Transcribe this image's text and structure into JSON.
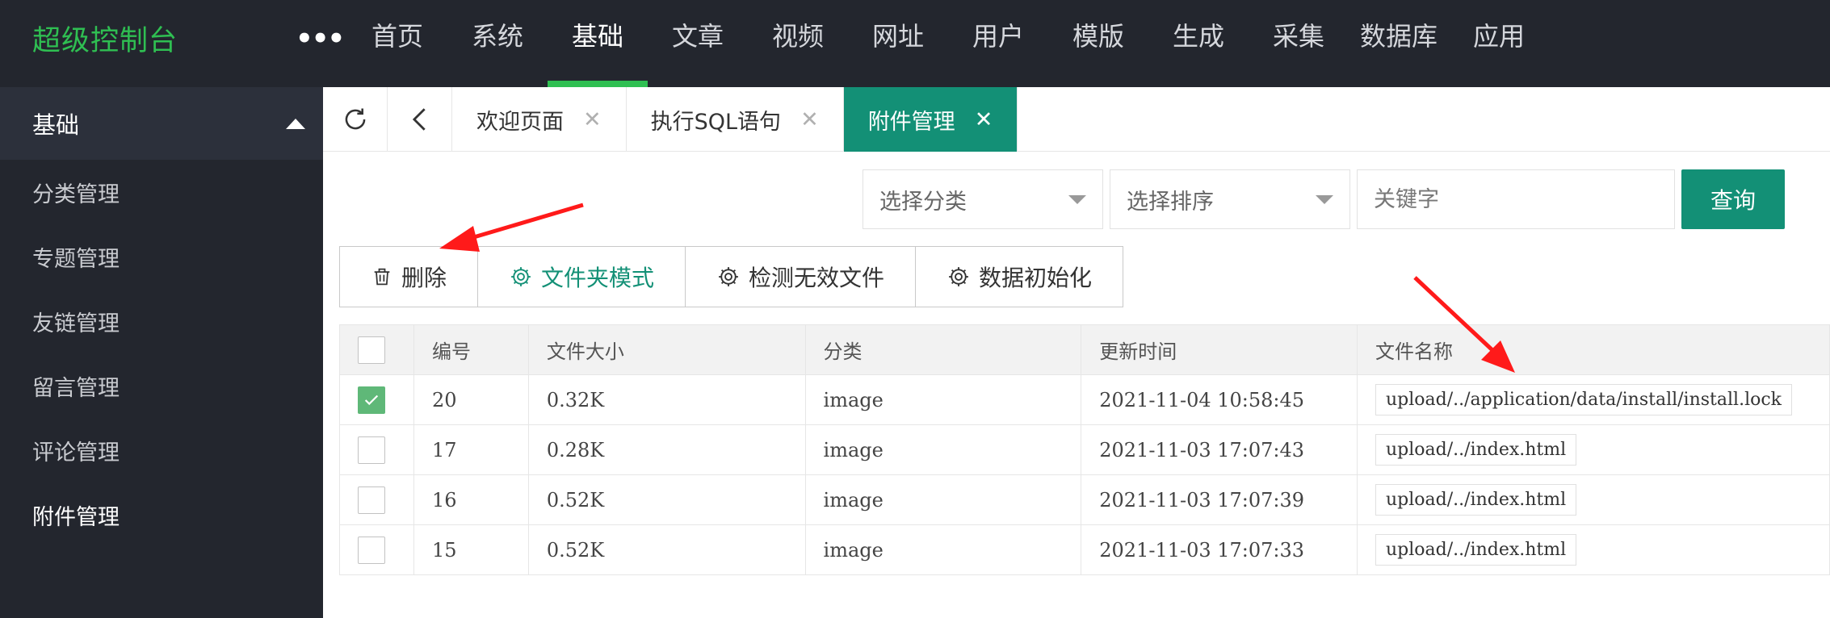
{
  "app": {
    "logo": "超级控制台",
    "more_icon": "ellipsis-icon"
  },
  "nav": {
    "items": [
      "首页",
      "系统",
      "基础",
      "文章",
      "视频",
      "网址",
      "用户",
      "模版",
      "生成",
      "采集",
      "数据库",
      "应用"
    ],
    "active": "基础"
  },
  "sidebar": {
    "section": "基础",
    "items": [
      "分类管理",
      "专题管理",
      "友链管理",
      "留言管理",
      "评论管理",
      "附件管理"
    ],
    "active": "附件管理"
  },
  "tabs": [
    {
      "label": "欢迎页面"
    },
    {
      "label": "执行SQL语句"
    },
    {
      "label": "附件管理",
      "active": true
    }
  ],
  "filters": {
    "category": "选择分类",
    "sort": "选择排序",
    "keyword_placeholder": "关键字",
    "query": "查询"
  },
  "actions": {
    "delete": "删除",
    "folder_mode": "文件夹模式",
    "detect_invalid": "检测无效文件",
    "init_data": "数据初始化"
  },
  "table": {
    "columns": [
      "编号",
      "文件大小",
      "分类",
      "更新时间",
      "文件名称"
    ],
    "rows": [
      {
        "id": "20",
        "size": "0.32K",
        "category": "image",
        "updated": "2021-11-04 10:58:45",
        "name": "upload/../application/data/install/install.lock",
        "checked": true
      },
      {
        "id": "17",
        "size": "0.28K",
        "category": "image",
        "updated": "2021-11-03 17:07:43",
        "name": "upload/../index.html",
        "checked": false
      },
      {
        "id": "16",
        "size": "0.52K",
        "category": "image",
        "updated": "2021-11-03 17:07:39",
        "name": "upload/../index.html",
        "checked": false
      },
      {
        "id": "15",
        "size": "0.52K",
        "category": "image",
        "updated": "2021-11-03 17:07:33",
        "name": "upload/../index.html",
        "checked": false
      }
    ]
  },
  "colors": {
    "accent": "#139076",
    "logo": "#2fbf52",
    "topbar": "#23262e",
    "annotation": "#ff1a1a"
  }
}
